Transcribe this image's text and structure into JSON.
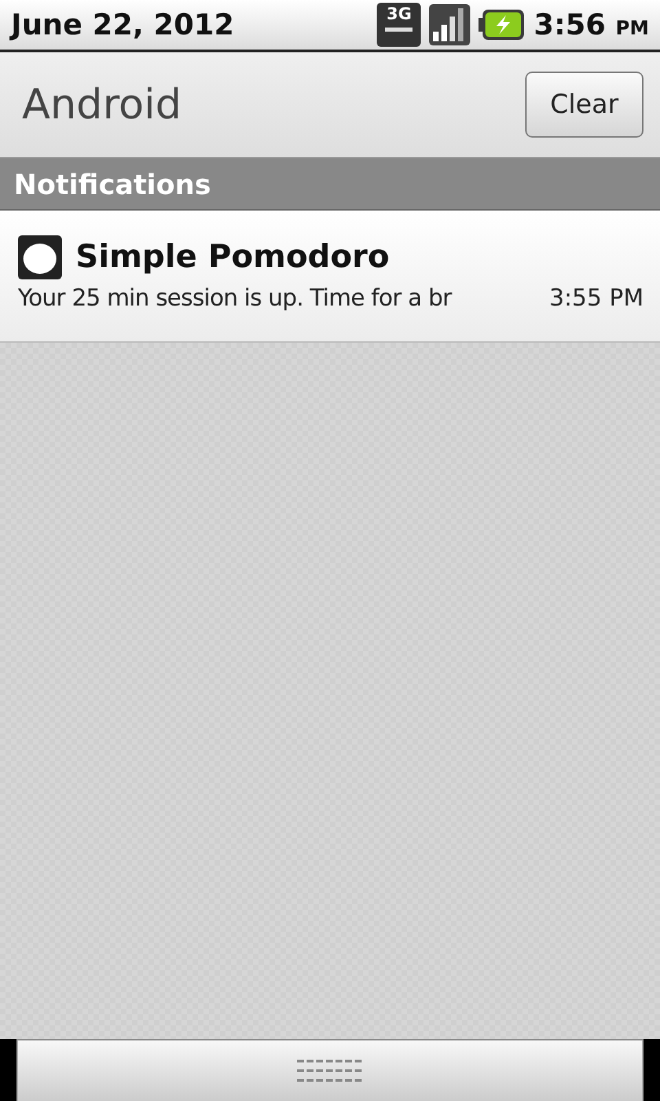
{
  "status_bar": {
    "date": "June 22, 2012",
    "network_type": "3G",
    "charging": true,
    "time": "3:56",
    "ampm": "PM"
  },
  "title_bar": {
    "title": "Android",
    "clear_button": "Clear"
  },
  "section": {
    "title": "Notifications"
  },
  "notifications": [
    {
      "app": "Simple Pomodoro",
      "text": "Your 25 min session is up. Time for a br",
      "time": "3:55 PM"
    }
  ]
}
